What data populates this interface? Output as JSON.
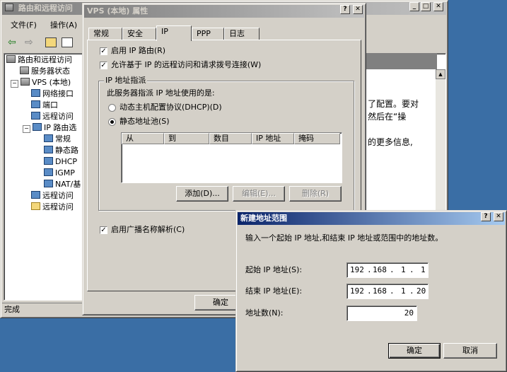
{
  "mmc": {
    "title": "路由和远程访问",
    "menu": [
      "文件(F)",
      "操作(A)"
    ],
    "tree": [
      {
        "label": "路由和远程访问",
        "indent": 0
      },
      {
        "label": "服务器状态",
        "indent": 1
      },
      {
        "label": "VPS (本地)",
        "indent": 1
      },
      {
        "label": "网络接口",
        "indent": 2
      },
      {
        "label": "端口",
        "indent": 2
      },
      {
        "label": "远程访问",
        "indent": 2
      },
      {
        "label": "IP 路由选",
        "indent": 2
      },
      {
        "label": "常规",
        "indent": 3
      },
      {
        "label": "静态路",
        "indent": 3
      },
      {
        "label": "DHCP",
        "indent": 3
      },
      {
        "label": "IGMP",
        "indent": 3
      },
      {
        "label": "NAT/基",
        "indent": 3
      },
      {
        "label": "远程访问",
        "indent": 2
      },
      {
        "label": "远程访问",
        "indent": 2
      }
    ],
    "right_text": [
      "了配置。要对",
      "然后在“操",
      "的更多信息,"
    ],
    "status": "完成"
  },
  "props": {
    "title": "VPS (本地) 属性",
    "tabs": [
      "常规",
      "安全",
      "IP",
      "PPP",
      "日志"
    ],
    "selected_tab": "IP",
    "enable_ip_routing": "启用 IP 路由(R)",
    "allow_ip_remote": "允许基于 IP 的远程访问和请求拨号连接(W)",
    "group_title": "IP 地址指派",
    "group_desc": "此服务器指派 IP 地址使用的是:",
    "dhcp_option": "动态主机配置协议(DHCP)(D)",
    "static_option": "静态地址池(S)",
    "columns": [
      "从",
      "到",
      "数目",
      "IP 地址",
      "掩码"
    ],
    "add_btn": "添加(D)...",
    "edit_btn": "编辑(E)...",
    "delete_btn": "删除(R)",
    "broadcast": "启用广播名称解析(C)",
    "ok_btn": "确定"
  },
  "dialog": {
    "title": "新建地址范围",
    "instruction": "输入一个起始 IP 地址,和结束 IP 地址或范围中的地址数。",
    "start_label": "起始 IP 地址(S):",
    "start_ip": [
      "192",
      "168",
      "1",
      "1"
    ],
    "end_label": "结束 IP 地址(E):",
    "end_ip": [
      "192",
      "168",
      "1",
      "20"
    ],
    "count_label": "地址数(N):",
    "count_value": "20",
    "ok_btn": "确定",
    "cancel_btn": "取消"
  }
}
